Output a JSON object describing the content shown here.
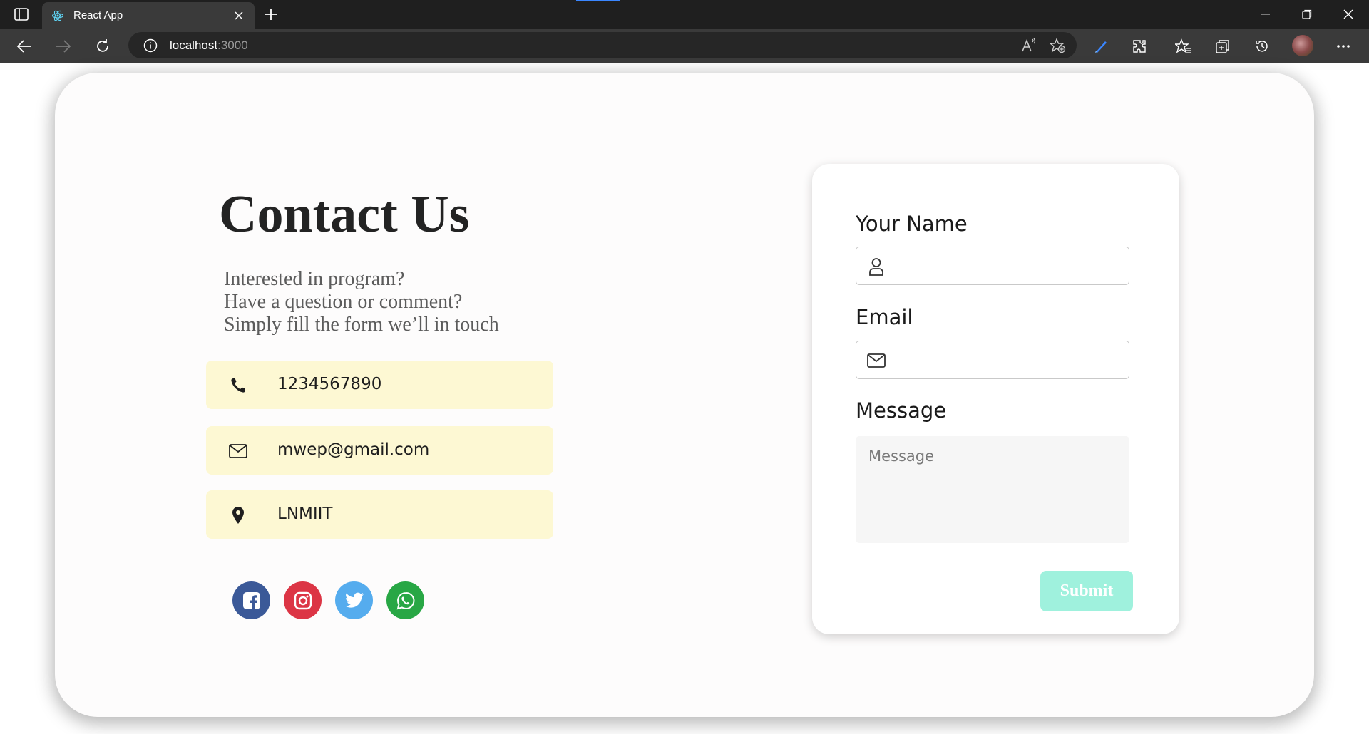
{
  "browser": {
    "tab_title": "React App",
    "address_host": "localhost",
    "address_port": ":3000"
  },
  "contact": {
    "title": "Contact Us",
    "subtitle_lines": [
      "Interested in program?",
      "Have a question or comment?",
      "Simply fill the form we’ll in touch"
    ],
    "phone": "1234567890",
    "email": "mwep@gmail.com",
    "location": "LNMIIT",
    "socials": [
      {
        "name": "facebook",
        "color": "#3b5998"
      },
      {
        "name": "instagram",
        "color": "#dc3545"
      },
      {
        "name": "twitter",
        "color": "#55acee"
      },
      {
        "name": "whatsapp",
        "color": "#28a745"
      }
    ],
    "info_bg": "#fdf8d3"
  },
  "form": {
    "name_label": "Your Name",
    "name_value": "",
    "email_label": "Email",
    "email_value": "",
    "message_label": "Message",
    "message_placeholder": "Message",
    "submit_label": "Submit",
    "submit_color": "#9ff1dd"
  }
}
